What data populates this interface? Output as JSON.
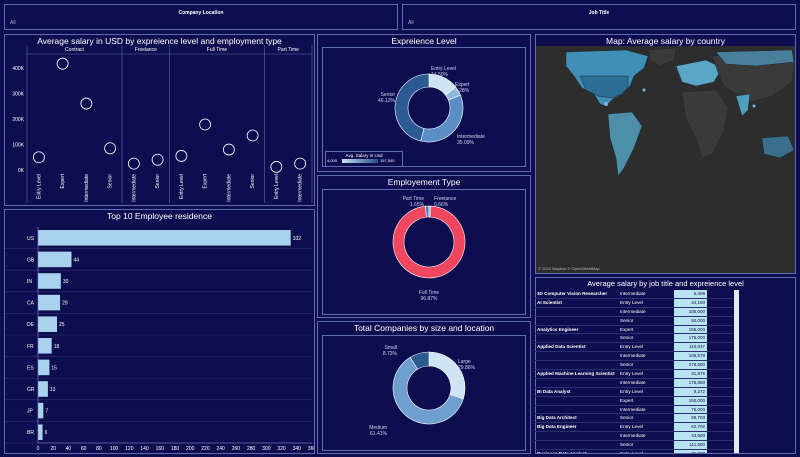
{
  "filters": {
    "location": {
      "label": "Company Location",
      "value": "All"
    },
    "job_title": {
      "label": "Job Title",
      "value": "All"
    }
  },
  "scatter": {
    "title": "Average salary in USD by expreience level and employment type",
    "groups": [
      "Contract",
      "Freelance",
      "Full Time",
      "Part Time"
    ],
    "y_ticks": [
      "400K",
      "300K",
      "200K",
      "100K",
      "0K"
    ]
  },
  "exp_level": {
    "title": "Expreience Level",
    "legend_title": "Avg. Salary in Usd",
    "legend_min": "4,000",
    "legend_max": "157,500",
    "labels": [
      {
        "name": "Entry Level",
        "pct": "14.50%"
      },
      {
        "name": "Expert",
        "pct": "4.28%"
      },
      {
        "name": "Senior",
        "pct": "46.13%"
      },
      {
        "name": "Intermediate",
        "pct": "35.09%"
      }
    ]
  },
  "map": {
    "title": "Map: Average salary by country",
    "credit": "© 2024 Mapbox © OpenStreetMap"
  },
  "emp_type": {
    "title": "Employement Type",
    "labels": [
      {
        "name": "Part Time",
        "pct": "1.65%"
      },
      {
        "name": "Freelance",
        "pct": "0.66%"
      },
      {
        "name": "Full Time",
        "pct": "96.87%"
      }
    ]
  },
  "top10": {
    "title": "Top 10 Employee residence",
    "x_ticks": [
      "0",
      "20",
      "40",
      "60",
      "80",
      "100",
      "120",
      "140",
      "160",
      "180",
      "200",
      "220",
      "240",
      "260",
      "280",
      "300",
      "320",
      "340",
      "360"
    ]
  },
  "companies": {
    "title": "Total Companies by size and location",
    "labels": [
      {
        "name": "Small",
        "pct": "8.73%"
      },
      {
        "name": "Large",
        "pct": "29.86%"
      },
      {
        "name": "Medium",
        "pct": "61.41%"
      }
    ]
  },
  "job_table": {
    "title": "Average salary by job title and expreience level",
    "rows": [
      {
        "title": "3D Computer Vision Researcher",
        "level": "Intermediate",
        "value": "5,409"
      },
      {
        "title": "AI Scientist",
        "level": "Entry Level",
        "value": "44,160"
      },
      {
        "title": "",
        "level": "Intermediate",
        "value": "105,000"
      },
      {
        "title": "",
        "level": "Senior",
        "value": "50,000"
      },
      {
        "title": "Analytics Engineer",
        "level": "Expert",
        "value": "155,000"
      },
      {
        "title": "",
        "level": "Senior",
        "value": "175,000"
      },
      {
        "title": "Applied Data Scientist",
        "level": "Entry Level",
        "value": "110,037"
      },
      {
        "title": "",
        "level": "Intermediate",
        "value": "105,578"
      },
      {
        "title": "",
        "level": "Senior",
        "value": "278,500"
      },
      {
        "title": "Applied Machine Learning Scientist",
        "level": "Entry Level",
        "value": "31,875"
      },
      {
        "title": "",
        "level": "Intermediate",
        "value": "178,850"
      },
      {
        "title": "BI Data Analyst",
        "level": "Entry Level",
        "value": "9,272"
      },
      {
        "title": "",
        "level": "Expert",
        "value": "150,000"
      },
      {
        "title": "",
        "level": "Intermediate",
        "value": "76,000"
      },
      {
        "title": "Big Data Architect",
        "level": "Senior",
        "value": "99,703"
      },
      {
        "title": "Big Data Engineer",
        "level": "Entry Level",
        "value": "62,702"
      },
      {
        "title": "",
        "level": "Intermediate",
        "value": "43,500"
      },
      {
        "title": "",
        "level": "Senior",
        "value": "111,500"
      },
      {
        "title": "Business Data Analyst",
        "level": "Entry Level",
        "value": "75,000"
      },
      {
        "title": "",
        "level": "Intermediate",
        "value": "74,785"
      },
      {
        "title": "Cloud Data Engineer",
        "level": "Intermediate",
        "value": "89,200"
      }
    ]
  },
  "chart_data": [
    {
      "type": "scatter",
      "title": "Average salary in USD by expreience level and employment type",
      "ylim": [
        0,
        450000
      ],
      "groups": [
        {
          "name": "Contract",
          "categories": [
            "Entry Level",
            "Expert",
            "Intermediate",
            "Senior"
          ],
          "values": [
            50000,
            416000,
            260000,
            85000
          ]
        },
        {
          "name": "Freelance",
          "categories": [
            "Intermediate",
            "Senior"
          ],
          "values": [
            25000,
            40000
          ]
        },
        {
          "name": "Full Time",
          "categories": [
            "Entry Level",
            "Expert",
            "Intermediate",
            "Senior"
          ],
          "values": [
            55000,
            178000,
            80000,
            135000
          ]
        },
        {
          "name": "Part Time",
          "categories": [
            "Entry Level",
            "Intermediate"
          ],
          "values": [
            12000,
            25000
          ]
        }
      ]
    },
    {
      "type": "pie",
      "title": "Expreience Level",
      "categories": [
        "Entry Level",
        "Expert",
        "Intermediate",
        "Senior"
      ],
      "values": [
        14.5,
        4.28,
        35.09,
        46.13
      ],
      "colors": [
        "#cfe4f2",
        "#8fb8da",
        "#5b8ec7",
        "#2c5a92"
      ]
    },
    {
      "type": "pie",
      "title": "Employement Type",
      "categories": [
        "Full Time",
        "Part Time",
        "Freelance"
      ],
      "values": [
        96.87,
        1.65,
        0.66
      ],
      "colors": [
        "#f0475f",
        "#4a7fb5",
        "#7fb1d9"
      ]
    },
    {
      "type": "bar",
      "title": "Top 10 Employee residence",
      "categories": [
        "US",
        "GB",
        "IN",
        "CA",
        "DE",
        "FR",
        "ES",
        "GR",
        "JP",
        "BR"
      ],
      "values": [
        332,
        44,
        30,
        29,
        25,
        18,
        15,
        13,
        7,
        6
      ],
      "xlim": [
        0,
        360
      ]
    },
    {
      "type": "pie",
      "title": "Total Companies by size and location",
      "categories": [
        "Large",
        "Medium",
        "Small"
      ],
      "values": [
        29.86,
        61.41,
        8.73
      ],
      "colors": [
        "#cfe4f2",
        "#6f9fcf",
        "#2c5a92"
      ]
    }
  ]
}
